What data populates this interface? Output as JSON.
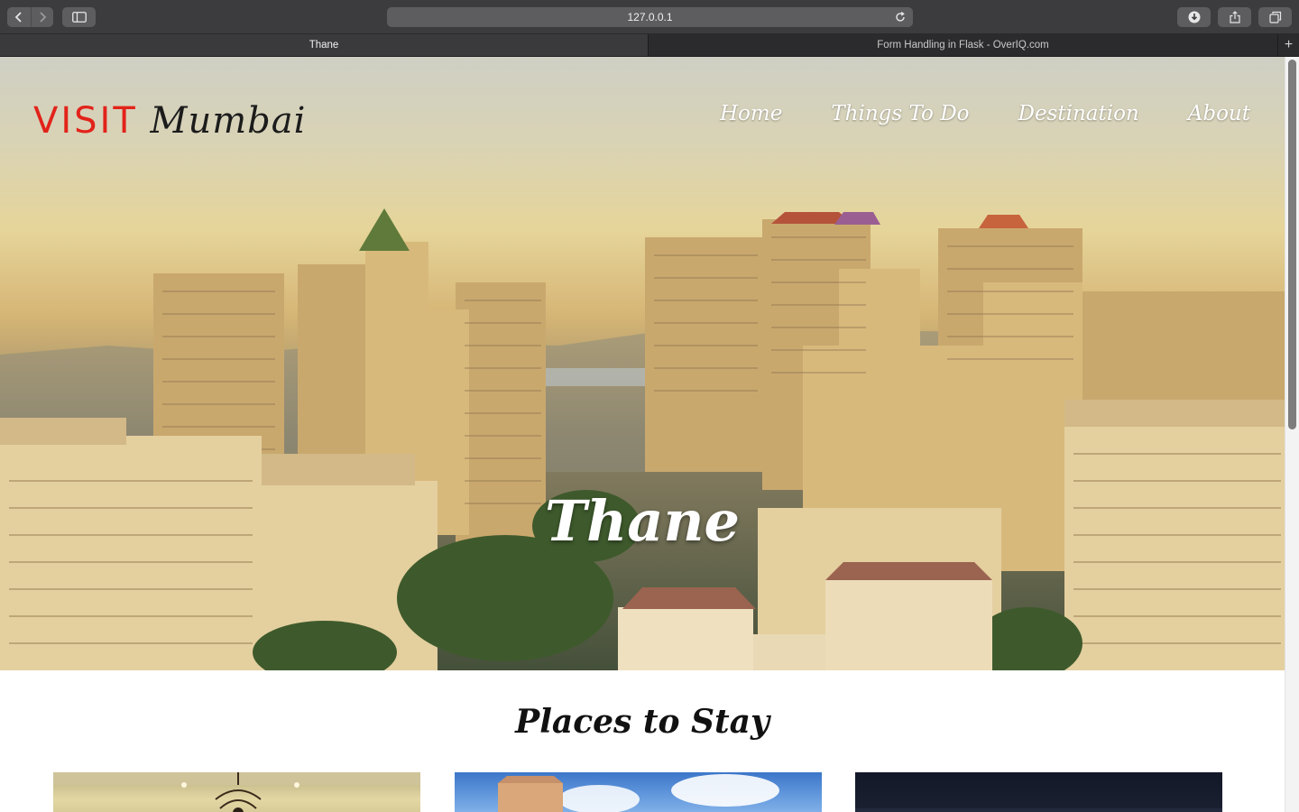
{
  "browser": {
    "url": "127.0.0.1",
    "tabs": [
      {
        "label": "Thane",
        "active": true
      },
      {
        "label": "Form Handling in Flask - OverIQ.com",
        "active": false
      }
    ],
    "icons": [
      "back-icon",
      "forward-icon",
      "sidebar-icon",
      "reload-icon",
      "download-icon",
      "share-icon",
      "tabs-overview-icon",
      "new-tab-icon"
    ]
  },
  "site": {
    "logo": {
      "visit": "VISIT",
      "city": "Mumbai"
    },
    "nav": [
      {
        "label": "Home"
      },
      {
        "label": "Things To Do"
      },
      {
        "label": "Destination"
      },
      {
        "label": "About"
      }
    ],
    "hero_title": "Thane",
    "section_title": "Places to Stay"
  },
  "colors": {
    "logo_visit": "#e2231a",
    "logo_city": "#1c1c1c",
    "nav_text": "#ffffff"
  }
}
